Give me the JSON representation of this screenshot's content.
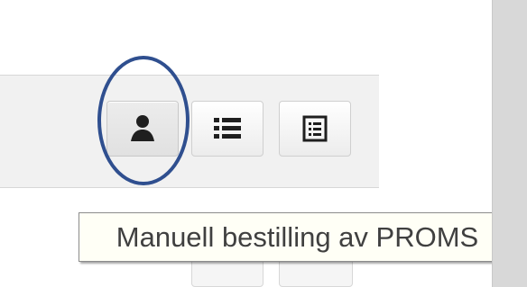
{
  "toolbar": {
    "buttons": [
      {
        "icon": "user-icon"
      },
      {
        "icon": "list-icon"
      },
      {
        "icon": "form-icon"
      }
    ]
  },
  "tooltip": {
    "text": "Manuell bestilling av PROMS"
  },
  "colors": {
    "highlight": "#2f4f8f",
    "icon": "#1f1f1f",
    "tooltip_bg": "#fffff6"
  }
}
